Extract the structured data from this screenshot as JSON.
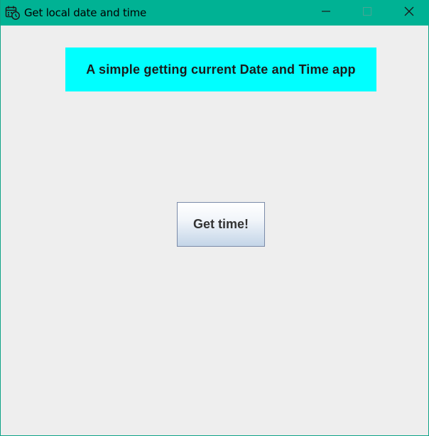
{
  "window": {
    "title": "Get local date and time",
    "app_icon": "calendar-clock-icon",
    "controls": {
      "minimize_icon": "minimize-icon",
      "maximize_icon": "maximize-icon",
      "close_icon": "close-icon"
    }
  },
  "main": {
    "banner_text": "A simple getting current Date and Time app",
    "get_time_label": "Get time!"
  },
  "colors": {
    "titlebar": "#00b294",
    "banner_bg": "#00ffff",
    "client_bg": "#eeeeee"
  }
}
